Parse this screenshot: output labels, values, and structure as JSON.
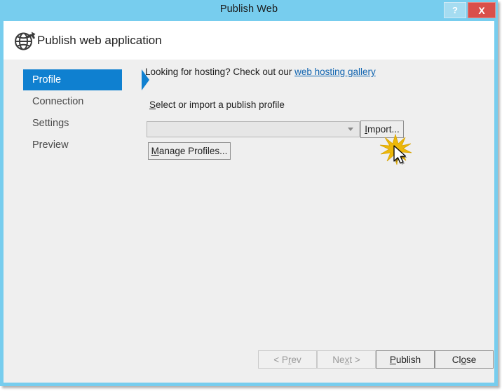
{
  "window": {
    "title": "Publish Web",
    "help_label": "?",
    "close_label": "X",
    "frame_color": "#77cdee",
    "close_button_color": "#d94f4a"
  },
  "header": {
    "title": "Publish web application",
    "icon": "globe-publish-icon"
  },
  "sidebar": {
    "selected": "Profile",
    "accent_color": "#0f80d0",
    "items": [
      {
        "label": "Profile"
      },
      {
        "label": "Connection"
      },
      {
        "label": "Settings"
      },
      {
        "label": "Preview"
      }
    ]
  },
  "main": {
    "hosting_prompt": "Looking for hosting? Check out our ",
    "hosting_link": "web hosting gallery",
    "hosting_link_color": "#1064b0",
    "profile_label_accel": "S",
    "profile_label_rest": "elect or import a publish profile",
    "profile_combo": {
      "value": "",
      "placeholder": ""
    },
    "import_button": {
      "accel": "I",
      "rest": "mport..."
    },
    "manage_profiles_button": {
      "accel": "M",
      "rest": "anage Profiles..."
    }
  },
  "footer": {
    "prev_button": {
      "pre": "< P",
      "accel": "r",
      "post": "ev"
    },
    "next_button": {
      "pre": "Ne",
      "accel": "x",
      "post": "t >"
    },
    "publish_button": {
      "pre": "",
      "accel": "P",
      "post": "ublish"
    },
    "close_button": {
      "pre": "Cl",
      "accel": "o",
      "post": "se"
    }
  },
  "pointer": {
    "cursor_icon": "arrow-cursor",
    "click_indicator": "click-burst",
    "burst_color": "#e8b007"
  }
}
